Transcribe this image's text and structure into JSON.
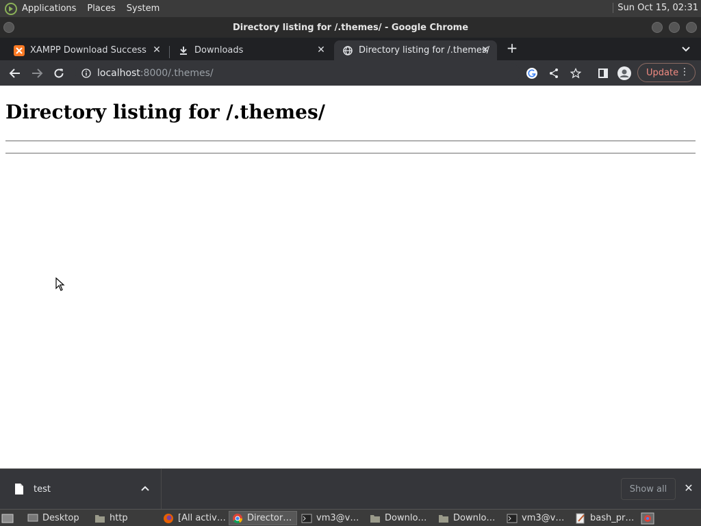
{
  "top_panel": {
    "menus": [
      "Applications",
      "Places",
      "System"
    ],
    "clock": "Sun Oct 15, 02:31"
  },
  "window": {
    "title": "Directory listing for /.themes/ - Google Chrome"
  },
  "tabs": [
    {
      "title": "XAMPP Download Success",
      "icon": "xampp-icon",
      "active": false
    },
    {
      "title": "Downloads",
      "icon": "download-icon",
      "active": false
    },
    {
      "title": "Directory listing for /.themes/",
      "icon": "globe-icon",
      "active": true
    }
  ],
  "toolbar": {
    "url_host": "localhost",
    "url_path": ":8000/.themes/",
    "update_label": "Update"
  },
  "page": {
    "heading": "Directory listing for /.themes/"
  },
  "download_shelf": {
    "file_name": "test",
    "show_all_label": "Show all"
  },
  "taskbar": {
    "items": [
      {
        "label": "Desktop",
        "icon": "desktop-icon",
        "active": false
      },
      {
        "label": "http",
        "icon": "folder-icon",
        "active": false
      },
      {
        "label": "[All activ…",
        "icon": "firefox-icon",
        "active": false
      },
      {
        "label": "Director…",
        "icon": "chrome-icon",
        "active": true
      },
      {
        "label": "vm3@v…",
        "icon": "terminal-icon",
        "active": false
      },
      {
        "label": "Downlo…",
        "icon": "folder-icon",
        "active": false
      },
      {
        "label": "Downlo…",
        "icon": "folder-icon",
        "active": false
      },
      {
        "label": "vm3@v…",
        "icon": "terminal-icon",
        "active": false
      },
      {
        "label": "bash_pr…",
        "icon": "text-editor-icon",
        "active": false
      }
    ]
  },
  "colors": {
    "panel_bg": "#3b3b3b",
    "tabstrip_bg": "#202124",
    "toolbar_bg": "#35363a",
    "update_accent": "#f28b82"
  }
}
